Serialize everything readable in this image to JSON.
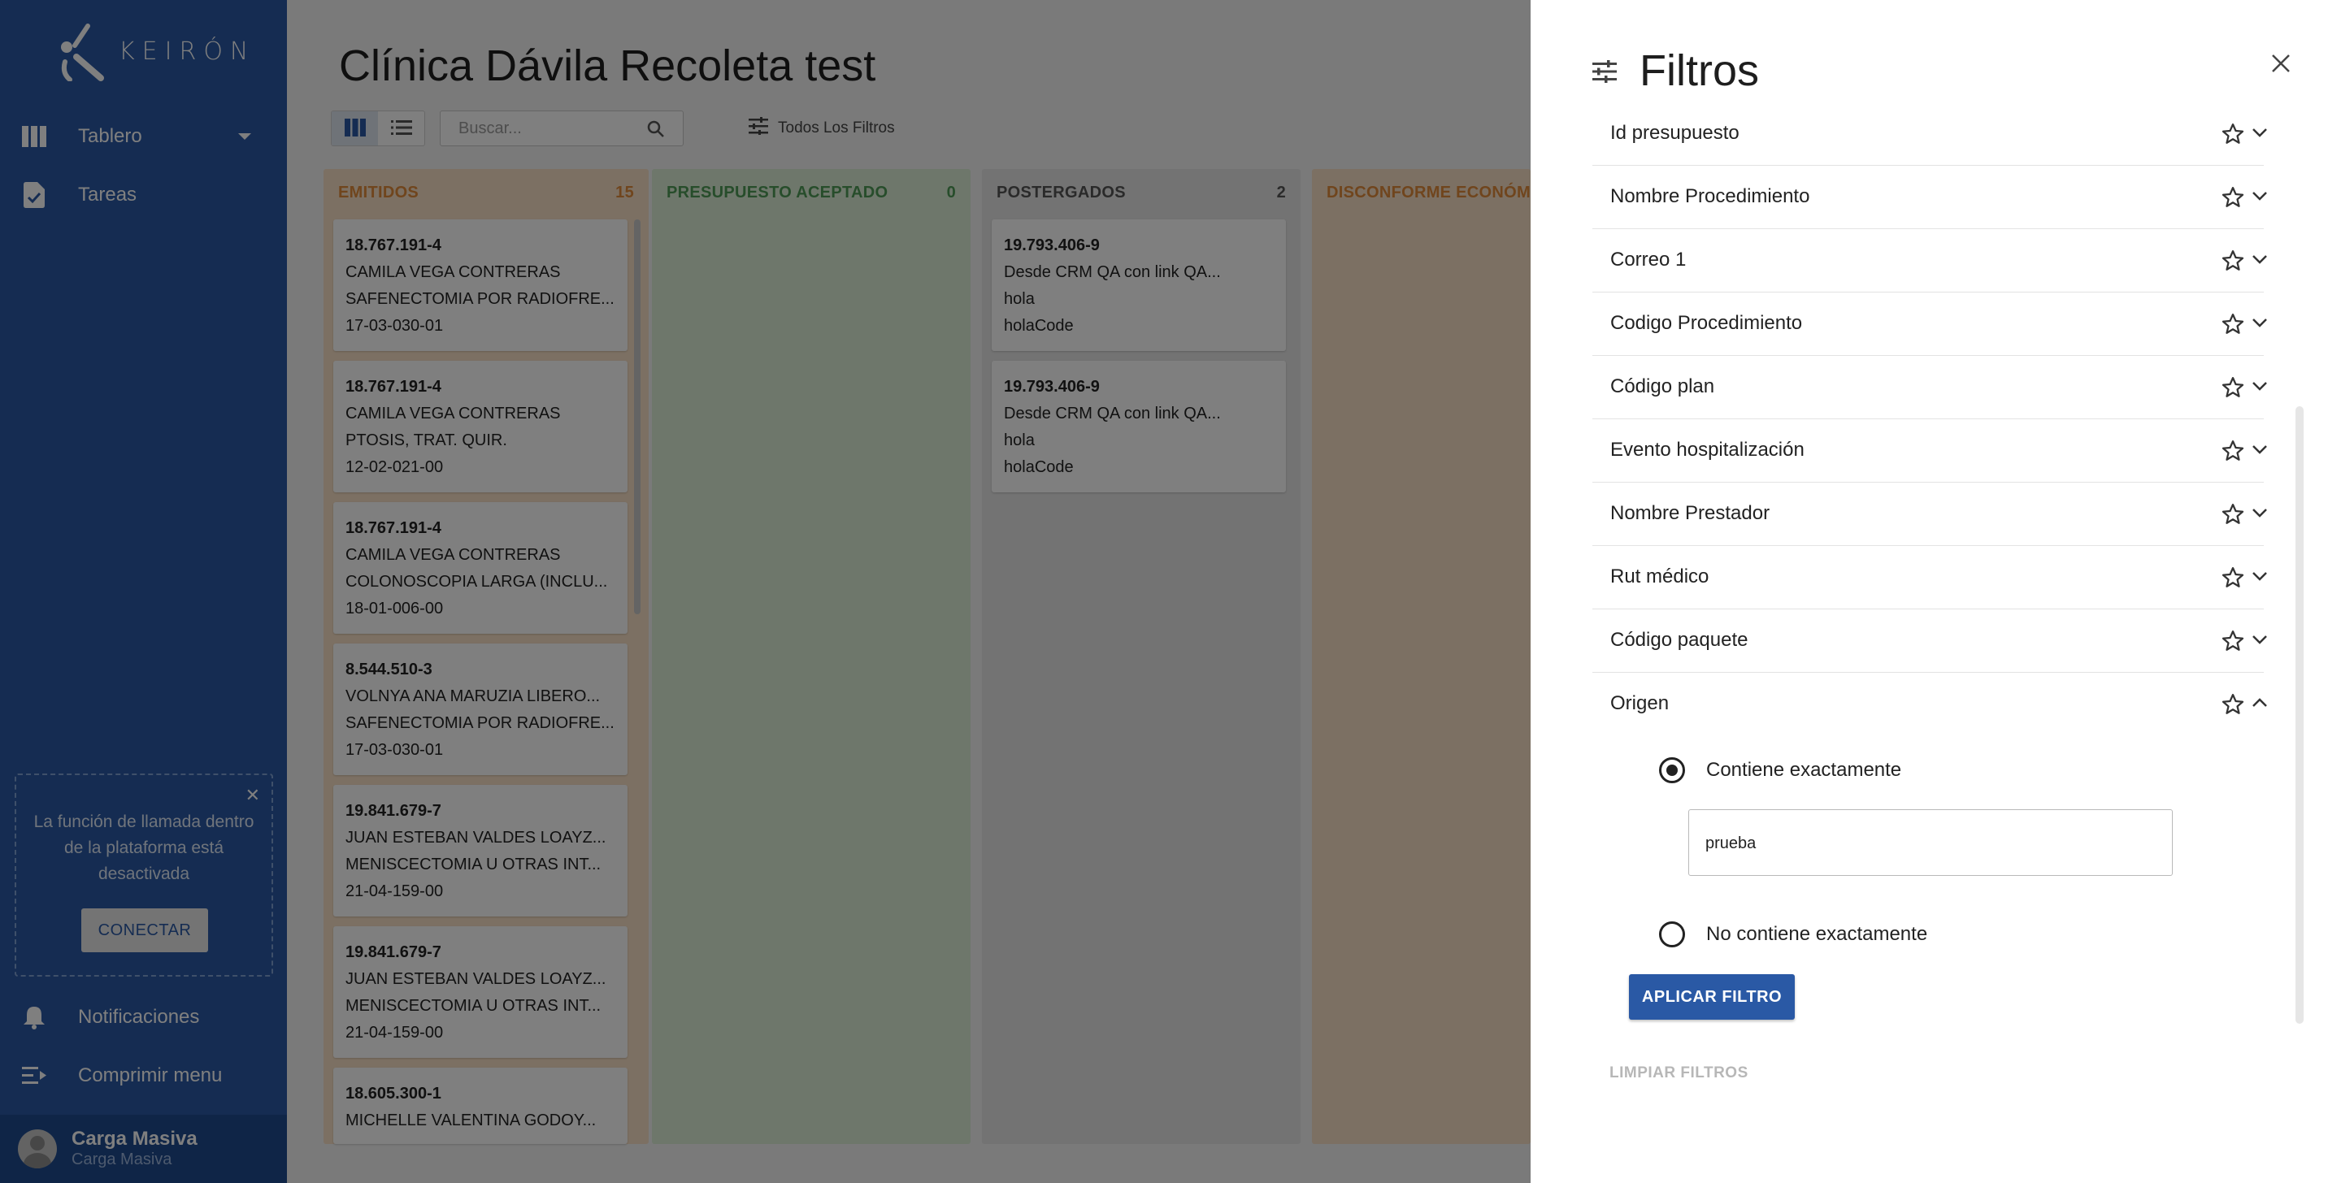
{
  "sidebar": {
    "brand": "KEIRÓN",
    "nav": [
      {
        "label": "Tablero",
        "icon": "board-icon"
      },
      {
        "label": "Tareas",
        "icon": "task-icon"
      }
    ],
    "callout": {
      "text": "La función de llamada dentro de la plataforma está desactivada",
      "button": "CONECTAR"
    },
    "bottom_nav": [
      {
        "label": "Notificaciones",
        "icon": "bell-icon"
      },
      {
        "label": "Comprimir menu",
        "icon": "collapse-menu-icon"
      }
    ],
    "user": {
      "name": "Carga Masiva",
      "role": "Carga Masiva"
    }
  },
  "main": {
    "title": "Clínica Dávila Recoleta test",
    "search_placeholder": "Buscar...",
    "all_filters_label": "Todos Los Filtros",
    "columns": [
      {
        "title": "EMITIDOS",
        "count": "15",
        "color": "#e08b3a",
        "bg": "#f9e1c6",
        "cards": [
          [
            "18.767.191-4",
            "CAMILA VEGA CONTRERAS",
            "SAFENECTOMIA POR RADIOFRE...",
            "17-03-030-01"
          ],
          [
            "18.767.191-4",
            "CAMILA VEGA CONTRERAS",
            "PTOSIS, TRAT. QUIR.",
            "12-02-021-00"
          ],
          [
            "18.767.191-4",
            "CAMILA VEGA CONTRERAS",
            "COLONOSCOPIA LARGA (INCLU...",
            "18-01-006-00"
          ],
          [
            "8.544.510-3",
            "VOLNYA ANA MARUZIA LIBERO...",
            "SAFENECTOMIA POR RADIOFRE...",
            "17-03-030-01"
          ],
          [
            "19.841.679-7",
            "JUAN ESTEBAN VALDES LOAYZ...",
            "MENISCECTOMIA U OTRAS INT...",
            "21-04-159-00"
          ],
          [
            "19.841.679-7",
            "JUAN ESTEBAN VALDES LOAYZ...",
            "MENISCECTOMIA U OTRAS INT...",
            "21-04-159-00"
          ],
          [
            "18.605.300-1",
            "MICHELLE VALENTINA GODOY...",
            "",
            ""
          ]
        ]
      },
      {
        "title": "PRESUPUESTO ACEPTADO",
        "count": "0",
        "color": "#4f9a57",
        "bg": "#dcefd6",
        "cards": []
      },
      {
        "title": "POSTERGADOS",
        "count": "2",
        "color": "#555555",
        "bg": "#e6e6e6",
        "cards": [
          [
            "19.793.406-9",
            "Desde CRM QA con link QA...",
            "hola",
            "holaCode"
          ],
          [
            "19.793.406-9",
            "Desde CRM QA con link QA...",
            "hola",
            "holaCode"
          ]
        ]
      },
      {
        "title": "DISCONFORME ECONÓMIC",
        "count": "",
        "color": "#e08b3a",
        "bg": "#f9e1c6",
        "cards": []
      }
    ]
  },
  "panel": {
    "title": "Filtros",
    "filters": [
      "Id presupuesto",
      "Nombre Procedimiento",
      "Correo 1",
      "Codigo Procedimiento",
      "Código plan",
      "Evento hospitalización",
      "Nombre Prestador",
      "Rut médico",
      "Código paquete",
      "Origen"
    ],
    "origen": {
      "option_contains": "Contiene exactamente",
      "value": "prueba",
      "option_not_contains": "No contiene exactamente",
      "selected": "contains"
    },
    "apply_label": "APLICAR FILTRO",
    "clear_label": "LIMPIAR FILTROS"
  }
}
